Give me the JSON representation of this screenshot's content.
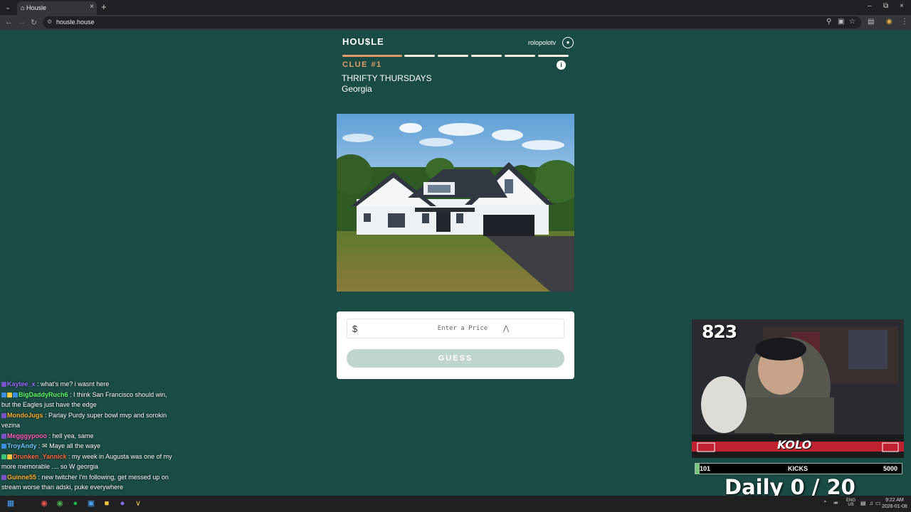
{
  "browser": {
    "tab_title": "Housle",
    "url": "housle.house",
    "menu_icon": "chevron-down-icon",
    "new_tab_icon": "plus-icon"
  },
  "header": {
    "logo": "HOU$LE",
    "username": "rolopolotv"
  },
  "progress": {
    "total": 6,
    "current": 1
  },
  "clue": {
    "label": "CLUE #1",
    "theme": "THRIFTY THURSDAYS",
    "location": "Georgia"
  },
  "guess": {
    "currency": "$",
    "placeholder": "Enter a Price",
    "button": "GUESS"
  },
  "chat": [
    {
      "user": "Kaytee_x",
      "msg": ": what's me? i wasnt here",
      "color": "#9d6bff",
      "badges": [
        "#7a52c7"
      ]
    },
    {
      "user": "BigDaddyRuch6",
      "msg": ": I think San Francisco should win, but the Eagles just have the edge",
      "color": "#5dff6a",
      "badges": [
        "#3c8fe0",
        "#f2c33c",
        "#3c8fe0"
      ]
    },
    {
      "user": "MondoJugs",
      "msg": ": Parlay Purdy super bowl mvp and sorokin vezina",
      "color": "#ffb02e",
      "badges": [
        "#7a52c7"
      ]
    },
    {
      "user": "Megggypooo",
      "msg": ": hell yea, same",
      "color": "#ff5fbf",
      "badges": [
        "#7a52c7"
      ]
    },
    {
      "user": "TroyAndy",
      "msg": ": ✉ Maye all the waye",
      "color": "#6fc5ff",
      "badges": [
        "#3c8fe0"
      ]
    },
    {
      "user": "Drunken_Yannick",
      "msg": ": my week in Augusta was one of my more memorable .... so W georgia",
      "color": "#ff6a3d",
      "badges": [
        "#3cc47a",
        "#f2c33c"
      ]
    },
    {
      "user": "Guinne55",
      "msg": ": new twitcher I'm following, get messed up on stream worse than adski, puke everywhere",
      "color": "#ffb02e",
      "badges": [
        "#7a52c7"
      ]
    }
  ],
  "stream": {
    "count": "823",
    "kicks_current": "101",
    "kicks_label": "KICKS",
    "kicks_goal": "5000",
    "kicks_fraction": 0.0202,
    "daily": "Daily  0 / 20",
    "brand": "KOLO"
  },
  "taskbar": {
    "lang": "ENG\nUS",
    "time": "9:22 AM",
    "date": "2026-01-08"
  },
  "colors": {
    "background": "#1b4b45",
    "accent": "#e29b67",
    "button_disabled": "#c0d5cf"
  }
}
